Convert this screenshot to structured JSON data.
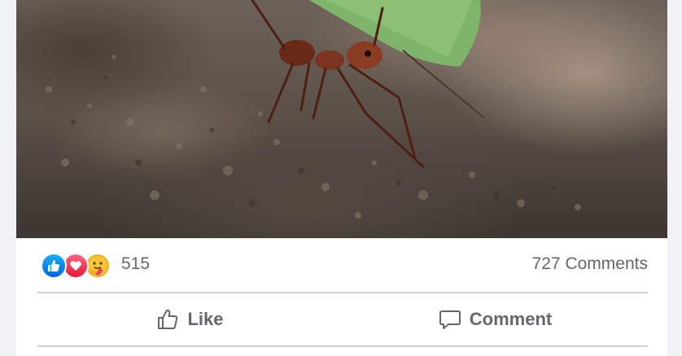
{
  "post": {
    "photo": {
      "subject": "leaf-cutter ant carrying leaf",
      "icon": "photo"
    },
    "reactions": {
      "icons": [
        "like-icon",
        "love-icon",
        "care-icon"
      ],
      "count": "515"
    },
    "comments_count": "727 Comments",
    "actions": {
      "like_label": "Like",
      "comment_label": "Comment"
    },
    "colors": {
      "like": "#1877f2",
      "love": "#f33e58",
      "care": "#f7b125",
      "muted_text": "#65676b",
      "divider": "#ced0d4"
    }
  }
}
